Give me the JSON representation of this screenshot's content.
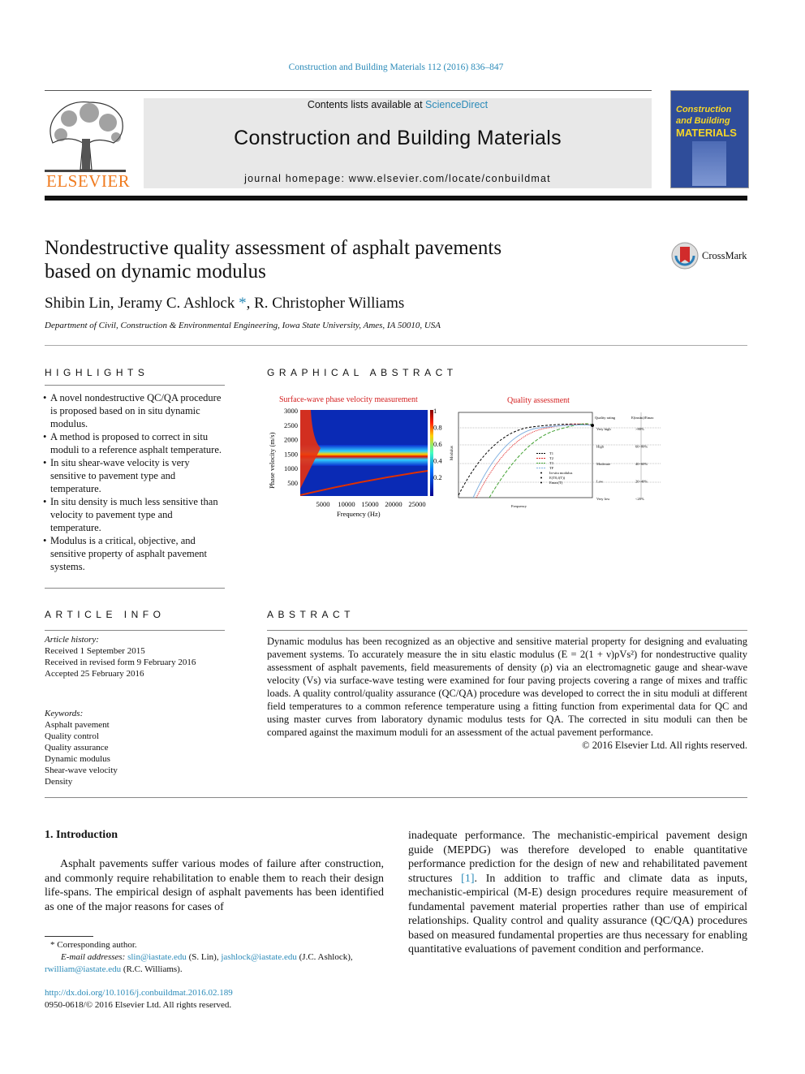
{
  "header": {
    "citation": "Construction and Building Materials 112 (2016) 836–847",
    "contents_prefix": "Contents lists available at ",
    "sciencedirect": "ScienceDirect",
    "journal_title": "Construction and Building Materials",
    "homepage": "journal homepage: www.elsevier.com/locate/conbuildmat",
    "publisher_logo": "ELSEVIER",
    "cover": {
      "line1": "Construction",
      "line2": "and Building",
      "line3": "MATERIALS",
      "color": "#2f4d9a"
    }
  },
  "article": {
    "title_line1": "Nondestructive quality assessment of asphalt pavements",
    "title_line2": "based on dynamic modulus",
    "authors": "Shibin Lin, Jeramy C. Ashlock",
    "author_mark": "*",
    "authors_rest": ", R. Christopher Williams",
    "affiliation": "Department of Civil, Construction & Environmental Engineering, Iowa State University, Ames, IA 50010, USA",
    "crossmark": "CrossMark"
  },
  "highlights": {
    "heading": "HIGHLIGHTS",
    "items": [
      "A novel nondestructive QC/QA procedure is proposed based on in situ dynamic modulus.",
      "A method is proposed to correct in situ moduli to a reference asphalt temperature.",
      "In situ shear-wave velocity is very sensitive to pavement type and temperature.",
      "In situ density is much less sensitive than velocity to pavement type and temperature.",
      "Modulus is a critical, objective, and sensitive property of asphalt pavement systems."
    ]
  },
  "graphical_abstract": {
    "heading": "GRAPHICAL ABSTRACT",
    "left_title": "Surface-wave phase velocity measurement",
    "left_ylabel": "Phase velocity (m/s)",
    "left_xlabel": "Frequency (Hz)",
    "left_yticks": [
      "3000",
      "2500",
      "2000",
      "1500",
      "1000",
      "500"
    ],
    "left_xticks": [
      "5000",
      "10000",
      "15000",
      "20000",
      "25000"
    ],
    "colorbar_ticks": [
      "1",
      "0.8",
      "0.6",
      "0.4",
      "0.2"
    ],
    "right_title": "Quality assessment",
    "right_ylabel": "Modulus",
    "right_xlabel": "Frequency",
    "legend": [
      "T1",
      "T2",
      "T3",
      "TF",
      "In-situ modulus",
      "E(T0,f(T))",
      "Emax(T)"
    ],
    "table_header": [
      "Quality rating",
      "E(insitu)/Emax"
    ],
    "ratings": [
      {
        "label": "Very high",
        "range": ">80%"
      },
      {
        "label": "High",
        "range": "60~80%"
      },
      {
        "label": "Moderate",
        "range": "40~60%"
      },
      {
        "label": "Low",
        "range": "20~40%"
      },
      {
        "label": "Very low",
        "range": "<20%"
      }
    ],
    "title_color": "#d42020"
  },
  "article_info": {
    "heading": "ARTICLE INFO",
    "history_label": "Article history:",
    "history": [
      "Received 1 September 2015",
      "Received in revised form 9 February 2016",
      "Accepted 25 February 2016"
    ],
    "keywords_label": "Keywords:",
    "keywords": [
      "Asphalt pavement",
      "Quality control",
      "Quality assurance",
      "Dynamic modulus",
      "Shear-wave velocity",
      "Density"
    ]
  },
  "abstract": {
    "heading": "ABSTRACT",
    "text": "Dynamic modulus has been recognized as an objective and sensitive material property for designing and evaluating pavement systems. To accurately measure the in situ elastic modulus (E = 2(1 + ν)ρVs²) for nondestructive quality assessment of asphalt pavements, field measurements of density (ρ) via an electromagnetic gauge and shear-wave velocity (Vs) via surface-wave testing were examined for four paving projects covering a range of mixes and traffic loads. A quality control/quality assurance (QC/QA) procedure was developed to correct the in situ moduli at different field temperatures to a common reference temperature using a fitting function from experimental data for QC and using master curves from laboratory dynamic modulus tests for QA. The corrected in situ moduli can then be compared against the maximum moduli for an assessment of the actual pavement performance.",
    "copyright": "© 2016 Elsevier Ltd. All rights reserved."
  },
  "introduction": {
    "heading": "1. Introduction",
    "para1": "Asphalt pavements suffer various modes of failure after construction, and commonly require rehabilitation to enable them to reach their design life-spans. The empirical design of asphalt pavements has been identified as one of the major reasons for cases of",
    "para2_a": "inadequate performance. The mechanistic-empirical pavement design guide (MEPDG) was therefore developed to enable quantitative performance prediction for the design of new and rehabilitated pavement structures ",
    "ref1": "[1]",
    "para2_b": ". In addition to traffic and climate data as inputs, mechanistic-empirical (M-E) design procedures require measurement of fundamental pavement material properties rather than use of empirical relationships. Quality control and quality assurance (QC/QA) procedures based on measured fundamental properties are thus necessary for enabling quantitative evaluations of pavement condition and performance."
  },
  "footnotes": {
    "corresponding": "* Corresponding author.",
    "email_label": "E-mail addresses:",
    "emails": [
      {
        "address": "slin@iastate.edu",
        "name": " (S. Lin), "
      },
      {
        "address": "jashlock@iastate.edu",
        "name": " (J.C. Ashlock),"
      },
      {
        "address": "rwilliam@iastate.edu",
        "name": " (R.C. Williams)."
      }
    ],
    "doi": "http://dx.doi.org/10.1016/j.conbuildmat.2016.02.189",
    "issn": "0950-0618/© 2016 Elsevier Ltd. All rights reserved."
  }
}
